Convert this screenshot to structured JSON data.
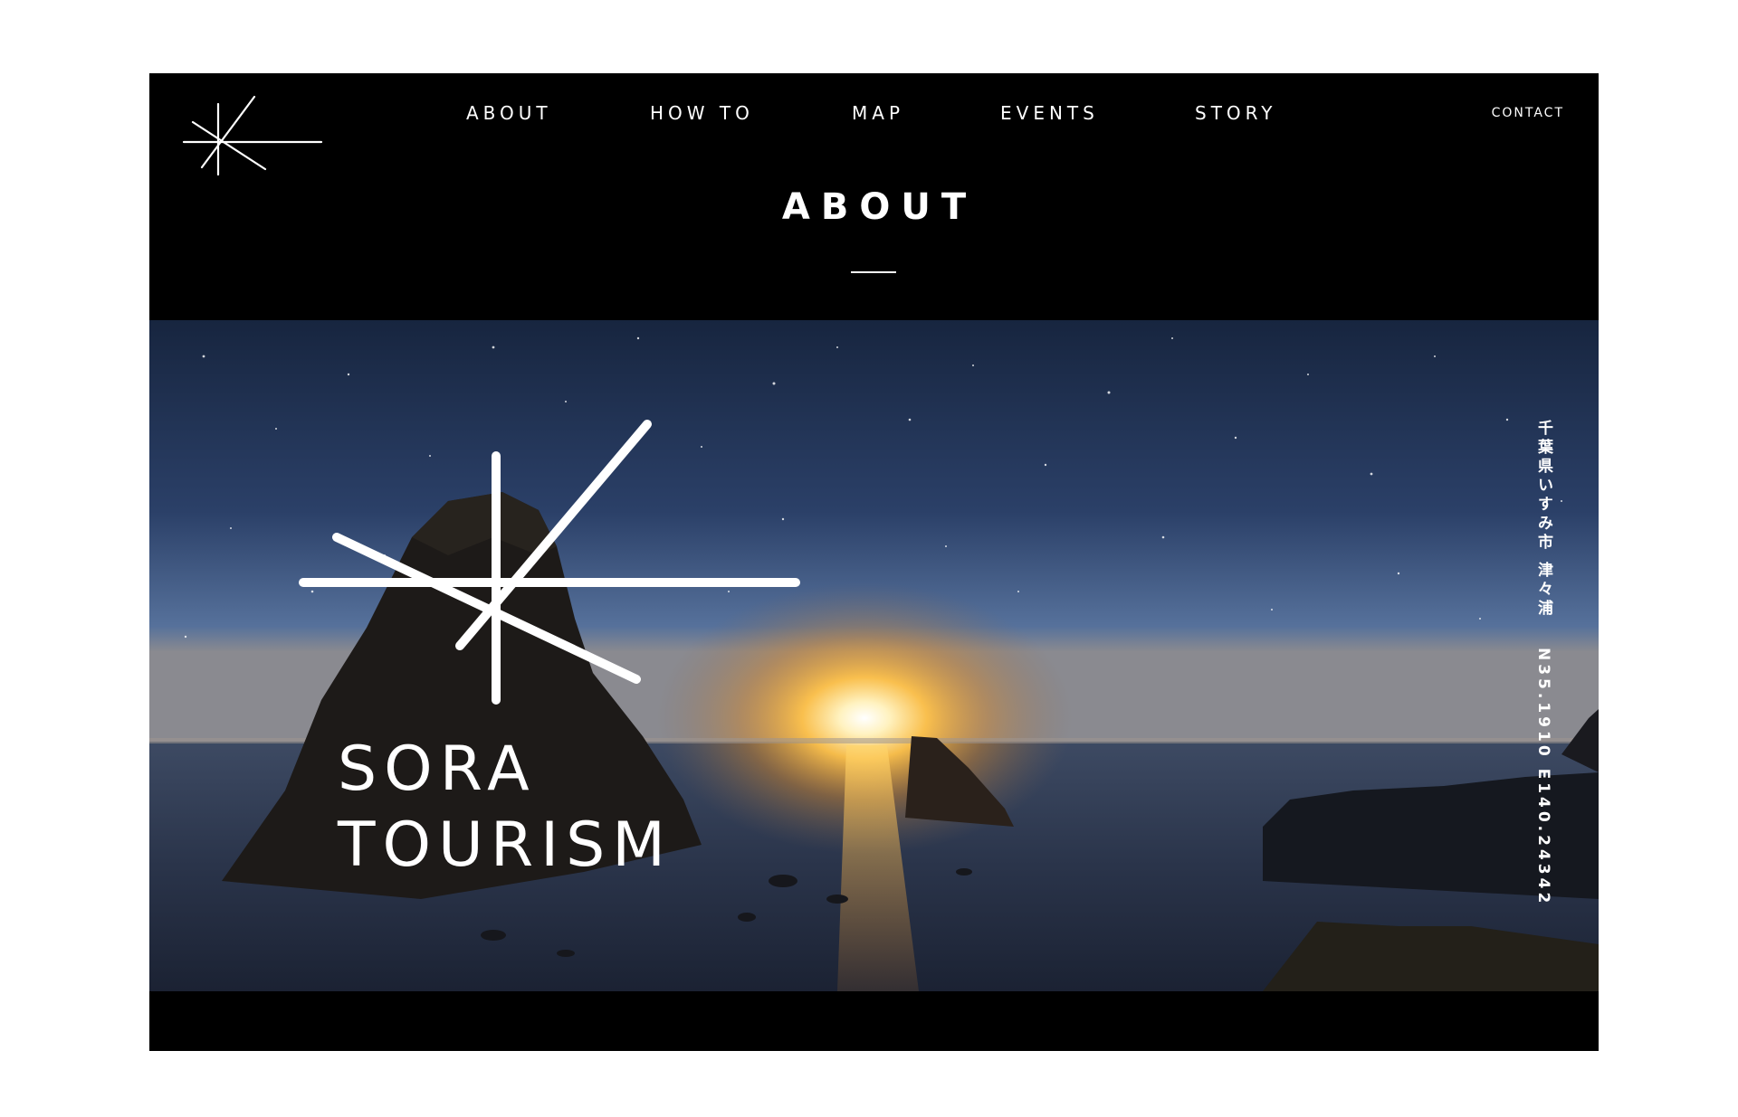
{
  "nav": {
    "items": [
      {
        "label": "ABOUT"
      },
      {
        "label": "HOW TO"
      },
      {
        "label": "MAP"
      },
      {
        "label": "EVENTS"
      },
      {
        "label": "STORY"
      }
    ],
    "contact": "CONTACT"
  },
  "page_title": "ABOUT",
  "hero": {
    "brand_line1": "SORA",
    "brand_line2": "TOURISM",
    "location": "千葉県いすみ市 津々浦",
    "coordinates": "N35.1910 E140.24342"
  },
  "icons": {
    "site_logo": "starburst-logo-icon",
    "hero_logo": "starburst-logo-icon"
  },
  "colors": {
    "background": "#000000",
    "text": "#ffffff",
    "sky_top": "#182640",
    "sky_horizon": "#4a6a96",
    "sun_glow": "#ffd36b"
  }
}
